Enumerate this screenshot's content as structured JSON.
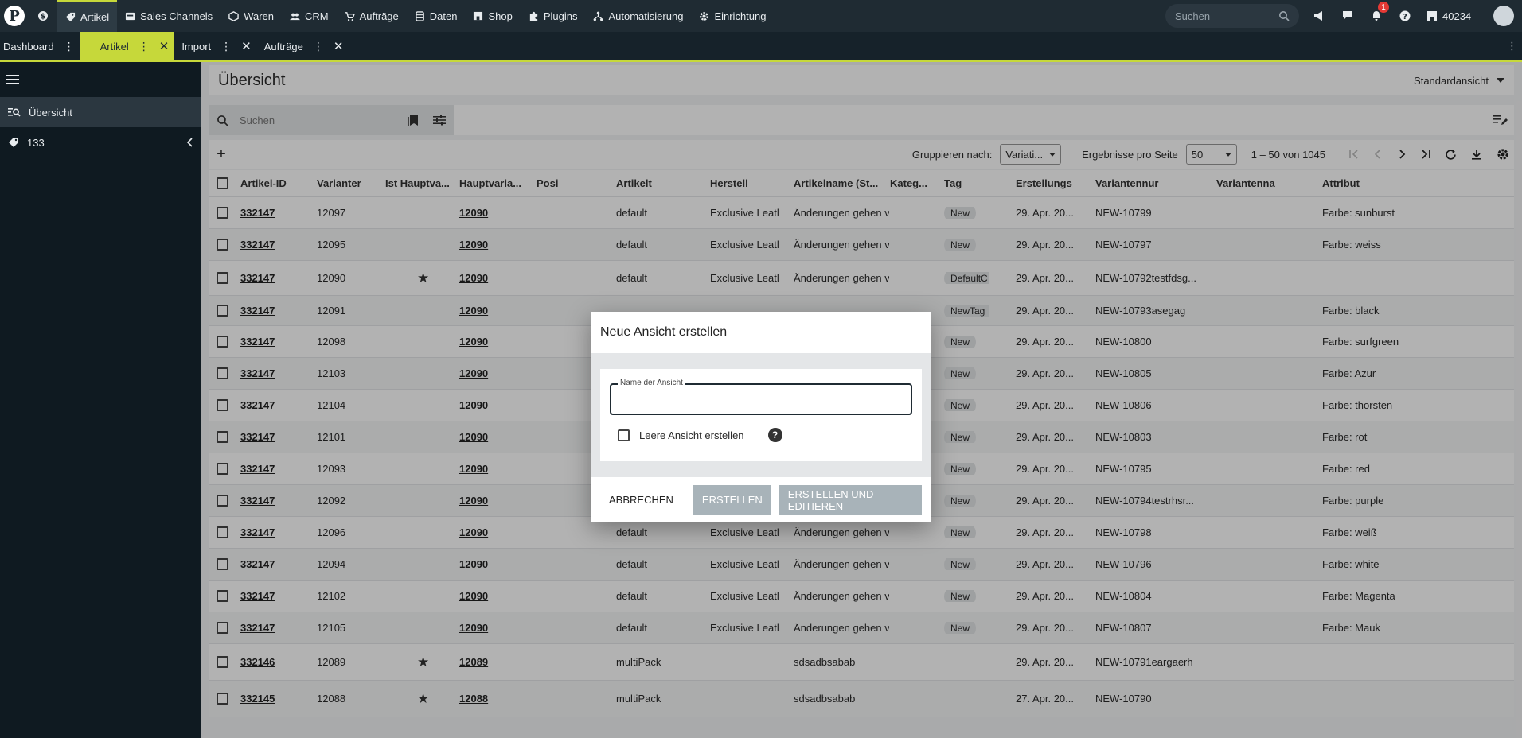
{
  "topnav": {
    "items": [
      {
        "label": "Artikel",
        "icon": "tag-icon",
        "active": true
      },
      {
        "label": "Sales Channels",
        "icon": "storefront-icon"
      },
      {
        "label": "Waren",
        "icon": "boxes-icon"
      },
      {
        "label": "CRM",
        "icon": "people-icon"
      },
      {
        "label": "Aufträge",
        "icon": "cart-icon"
      },
      {
        "label": "Daten",
        "icon": "database-icon"
      },
      {
        "label": "Shop",
        "icon": "shop-icon"
      },
      {
        "label": "Plugins",
        "icon": "puzzle-icon"
      },
      {
        "label": "Automatisierung",
        "icon": "flow-icon"
      },
      {
        "label": "Einrichtung",
        "icon": "gear-icon"
      }
    ],
    "search_placeholder": "Suchen",
    "notification_count": "1",
    "store_id": "40234"
  },
  "tabs": [
    {
      "label": "Dashboard"
    },
    {
      "label": "Artikel",
      "active": true
    },
    {
      "label": "Import"
    },
    {
      "label": "Aufträge"
    }
  ],
  "sidebar": {
    "items": [
      {
        "label": "Übersicht",
        "active": true
      },
      {
        "label": "133"
      }
    ]
  },
  "main": {
    "title": "Übersicht",
    "view_label": "Standardansicht",
    "search_placeholder": "Suchen",
    "group_by_label": "Gruppieren nach:",
    "group_by_value": "Variati...",
    "per_page_label": "Ergebnisse pro Seite",
    "per_page_value": "50",
    "range_text": "1 – 50 von 1045"
  },
  "table": {
    "headers": [
      "Artikel-ID",
      "Varianter",
      "Ist Hauptva...",
      "Hauptvaria...",
      "Posi",
      "Artikelt",
      "Herstell",
      "Artikelname (St...",
      "Kateg...",
      "Tag",
      "Erstellungs",
      "Variantennur",
      "Variantenna",
      "Attribut"
    ],
    "rows": [
      {
        "id": "332147",
        "var": "12097",
        "main": false,
        "mainvar": "12090",
        "type": "default",
        "maker": "Exclusive Leatl",
        "name": "Änderungen gehen v",
        "tag": "New",
        "created": "29. Apr. 20...",
        "varnum": "NEW-10799",
        "attr": "Farbe: sunburst"
      },
      {
        "id": "332147",
        "var": "12095",
        "main": false,
        "mainvar": "12090",
        "type": "default",
        "maker": "Exclusive Leatl",
        "name": "Änderungen gehen v",
        "tag": "New",
        "created": "29. Apr. 20...",
        "varnum": "NEW-10797",
        "attr": "Farbe: weiss"
      },
      {
        "id": "332147",
        "var": "12090",
        "main": true,
        "mainvar": "12090",
        "type": "default",
        "maker": "Exclusive Leatl",
        "name": "Änderungen gehen v",
        "tag": "DefaultC",
        "created": "29. Apr. 20...",
        "varnum": "NEW-10792testfdsg...",
        "attr": ""
      },
      {
        "id": "332147",
        "var": "12091",
        "main": false,
        "mainvar": "12090",
        "type": "",
        "maker": "",
        "name": "",
        "tag": "NewTag",
        "created": "29. Apr. 20...",
        "varnum": "NEW-10793asegag",
        "attr": "Farbe: black"
      },
      {
        "id": "332147",
        "var": "12098",
        "main": false,
        "mainvar": "12090",
        "type": "",
        "maker": "",
        "name": "",
        "tag": "New",
        "created": "29. Apr. 20...",
        "varnum": "NEW-10800",
        "attr": "Farbe: surfgreen"
      },
      {
        "id": "332147",
        "var": "12103",
        "main": false,
        "mainvar": "12090",
        "type": "",
        "maker": "",
        "name": "",
        "tag": "New",
        "created": "29. Apr. 20...",
        "varnum": "NEW-10805",
        "attr": "Farbe: Azur"
      },
      {
        "id": "332147",
        "var": "12104",
        "main": false,
        "mainvar": "12090",
        "type": "",
        "maker": "",
        "name": "",
        "tag": "New",
        "created": "29. Apr. 20...",
        "varnum": "NEW-10806",
        "attr": "Farbe: thorsten"
      },
      {
        "id": "332147",
        "var": "12101",
        "main": false,
        "mainvar": "12090",
        "type": "",
        "maker": "",
        "name": "",
        "tag": "New",
        "created": "29. Apr. 20...",
        "varnum": "NEW-10803",
        "attr": "Farbe: rot"
      },
      {
        "id": "332147",
        "var": "12093",
        "main": false,
        "mainvar": "12090",
        "type": "",
        "maker": "",
        "name": "",
        "tag": "New",
        "created": "29. Apr. 20...",
        "varnum": "NEW-10795",
        "attr": "Farbe: red"
      },
      {
        "id": "332147",
        "var": "12092",
        "main": false,
        "mainvar": "12090",
        "type": "",
        "maker": "",
        "name": "",
        "tag": "New",
        "created": "29. Apr. 20...",
        "varnum": "NEW-10794testrhsr...",
        "attr": "Farbe: purple"
      },
      {
        "id": "332147",
        "var": "12096",
        "main": false,
        "mainvar": "12090",
        "type": "default",
        "maker": "Exclusive Leatl",
        "name": "Änderungen gehen v",
        "tag": "New",
        "created": "29. Apr. 20...",
        "varnum": "NEW-10798",
        "attr": "Farbe: weiß"
      },
      {
        "id": "332147",
        "var": "12094",
        "main": false,
        "mainvar": "12090",
        "type": "default",
        "maker": "Exclusive Leatl",
        "name": "Änderungen gehen v",
        "tag": "New",
        "created": "29. Apr. 20...",
        "varnum": "NEW-10796",
        "attr": "Farbe: white"
      },
      {
        "id": "332147",
        "var": "12102",
        "main": false,
        "mainvar": "12090",
        "type": "default",
        "maker": "Exclusive Leatl",
        "name": "Änderungen gehen v",
        "tag": "New",
        "created": "29. Apr. 20...",
        "varnum": "NEW-10804",
        "attr": "Farbe: Magenta"
      },
      {
        "id": "332147",
        "var": "12105",
        "main": false,
        "mainvar": "12090",
        "type": "default",
        "maker": "Exclusive Leatl",
        "name": "Änderungen gehen v",
        "tag": "New",
        "created": "29. Apr. 20...",
        "varnum": "NEW-10807",
        "attr": "Farbe: Mauk"
      },
      {
        "id": "332146",
        "var": "12089",
        "main": true,
        "mainvar": "12089",
        "type": "multiPack",
        "maker": "",
        "name": "sdsadbsabab",
        "tag": "",
        "created": "29. Apr. 20...",
        "varnum": "NEW-10791eargaerh",
        "attr": ""
      },
      {
        "id": "332145",
        "var": "12088",
        "main": true,
        "mainvar": "12088",
        "type": "multiPack",
        "maker": "",
        "name": "sdsadbsabab",
        "tag": "",
        "created": "27. Apr. 20...",
        "varnum": "NEW-10790",
        "attr": ""
      }
    ]
  },
  "dialog": {
    "title": "Neue Ansicht erstellen",
    "field_label": "Name der Ansicht",
    "field_value": "",
    "checkbox_label": "Leere Ansicht erstellen",
    "cancel": "Abbrechen",
    "create": "Erstellen",
    "create_edit": "Erstellen und Editieren"
  },
  "colors": {
    "accent": "#c6d83a",
    "topbar": "#1f2b33",
    "sidebar": "#0f1a21",
    "disabled_button": "#a8b3b9"
  }
}
